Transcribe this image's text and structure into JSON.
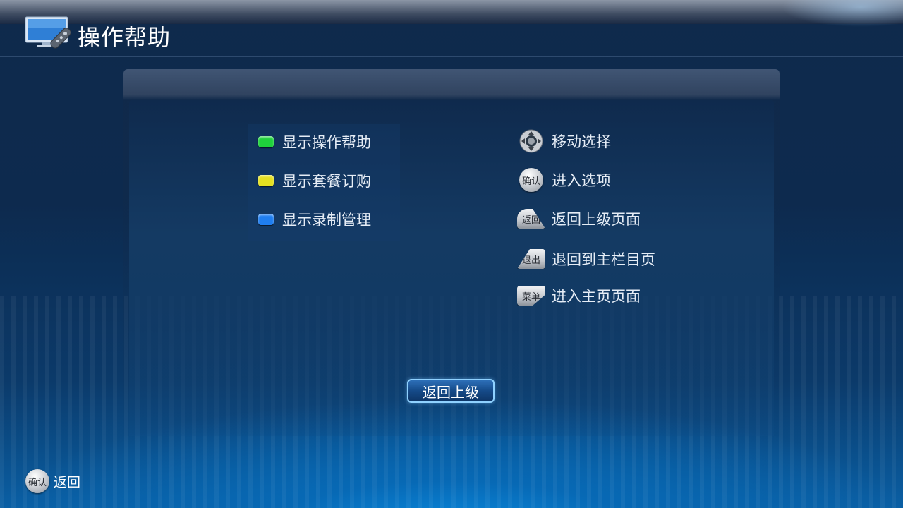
{
  "header": {
    "title": "操作帮助",
    "logo_icon": "tv-remote-icon"
  },
  "color_keys": [
    {
      "label": "显示操作帮助",
      "color": "#1fd23c",
      "icon": "green-key-icon"
    },
    {
      "label": "显示套餐订购",
      "color": "#e5e021",
      "icon": "yellow-key-icon"
    },
    {
      "label": "显示录制管理",
      "color": "#1f7ef0",
      "icon": "blue-key-icon"
    }
  ],
  "remote_keys": [
    {
      "label": "移动选择",
      "icon": "dpad-icon",
      "key_text": ""
    },
    {
      "label": "进入选项",
      "icon": "ok-key-icon",
      "key_text": "确认"
    },
    {
      "label": "返回上级页面",
      "icon": "back-key-icon",
      "key_text": "返回"
    },
    {
      "label": "退回到主栏目页",
      "icon": "exit-key-icon",
      "key_text": "退出"
    },
    {
      "label": "进入主页页面",
      "icon": "menu-key-icon",
      "key_text": "菜单"
    }
  ],
  "back_button": {
    "label": "返回上级"
  },
  "footer": {
    "key_text": "确认",
    "label": "返回",
    "icon": "ok-key-icon"
  }
}
